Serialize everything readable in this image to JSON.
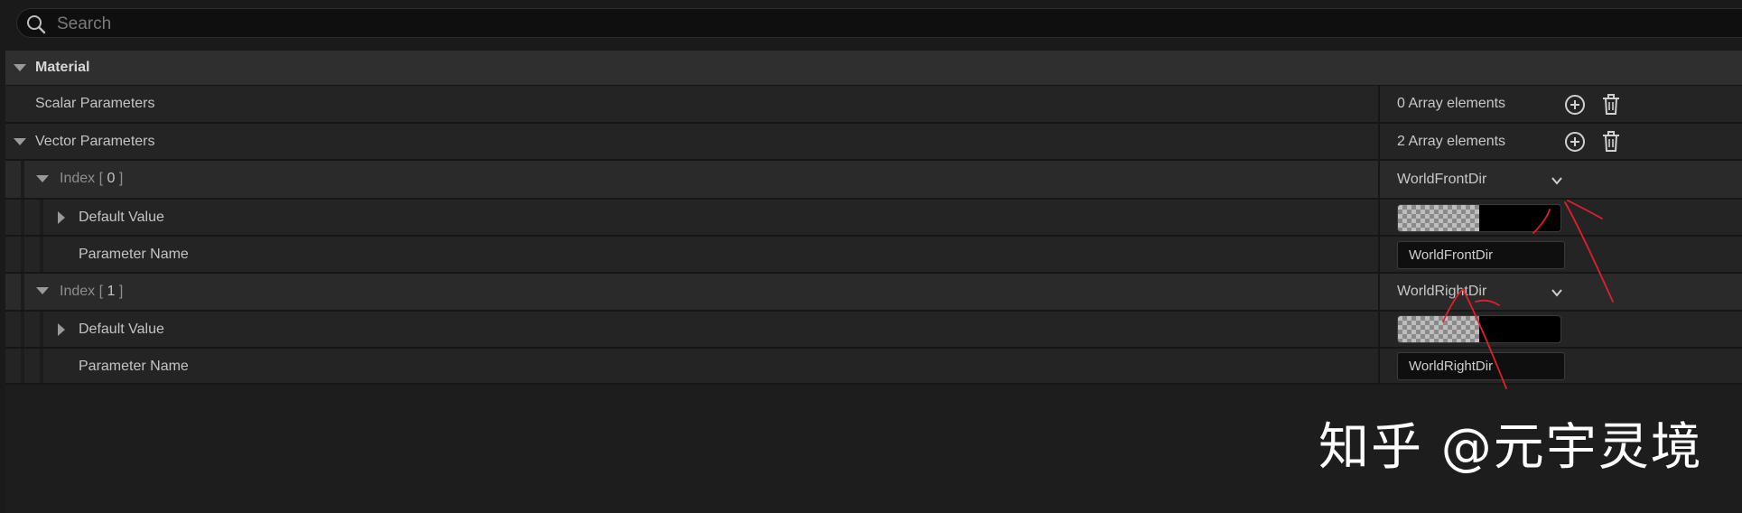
{
  "search": {
    "placeholder": "Search",
    "value": ""
  },
  "category": {
    "title": "Material"
  },
  "rows": {
    "scalar": {
      "label": "Scalar Parameters",
      "value": "0 Array elements"
    },
    "vector": {
      "label": "Vector Parameters",
      "value": "2 Array elements"
    },
    "index0": {
      "prefix": "Index [ ",
      "num": "0",
      "suffix": " ]",
      "value": "WorldFrontDir"
    },
    "index0_default": {
      "label": "Default Value"
    },
    "index0_param": {
      "label": "Parameter Name",
      "value": "WorldFrontDir"
    },
    "index1": {
      "prefix": "Index [ ",
      "num": "1",
      "suffix": " ]",
      "value": "WorldRightDir"
    },
    "index1_default": {
      "label": "Default Value"
    },
    "index1_param": {
      "label": "Parameter Name",
      "value": "WorldRightDir"
    }
  },
  "watermark": {
    "text": "知乎 @元宇灵境"
  },
  "colors": {
    "background": "#1a1a1a",
    "row": "#242424",
    "category": "#2f2f2f",
    "annotation": "#e0202a"
  },
  "icons": {
    "search": "search-icon",
    "add": "plus-circle-icon",
    "delete": "trash-icon",
    "expanded": "triangle-down-icon",
    "collapsed": "triangle-right-icon",
    "dropdown": "chevron-down-icon"
  }
}
